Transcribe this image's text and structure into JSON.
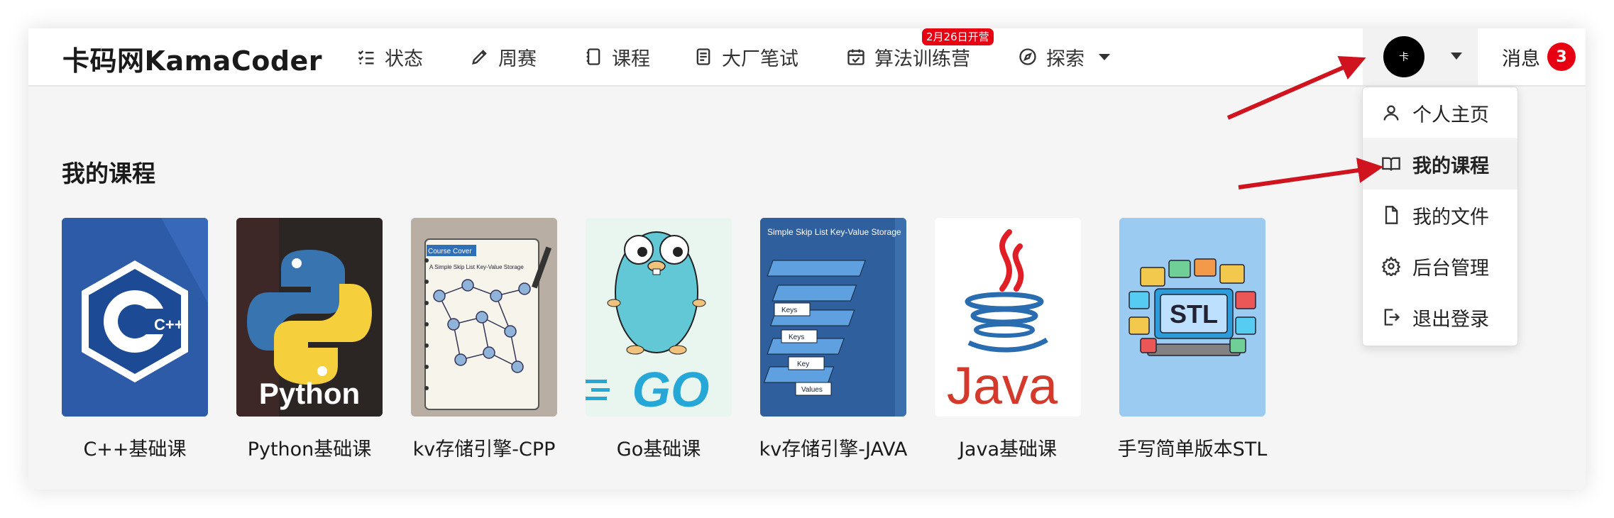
{
  "nav": {
    "logo": "卡码网KamaCoder",
    "items": [
      {
        "label": "状态",
        "icon": "list-check-icon"
      },
      {
        "label": "周赛",
        "icon": "pencil-icon"
      },
      {
        "label": "课程",
        "icon": "notebook-icon"
      },
      {
        "label": "大厂笔试",
        "icon": "document-icon"
      },
      {
        "label": "算法训练营",
        "icon": "calendar-check-icon"
      },
      {
        "label": "探索",
        "icon": "compass-icon"
      }
    ],
    "promo_badge": "2月26日开营",
    "avatar_text": "卡",
    "messages_label": "消息",
    "messages_count": "3"
  },
  "main": {
    "section_title": "我的课程",
    "courses": [
      {
        "name": "C++基础课",
        "cover_text": "C++",
        "bg": "#2b5aa6"
      },
      {
        "name": "Python基础课",
        "cover_text": "Python",
        "bg": "#2a2a2a"
      },
      {
        "name": "kv存储引擎-CPP",
        "cover_text": "A Simple Skip List Key-Value Storage",
        "cover_title": "Course Cover",
        "bg": "#c9c2b8"
      },
      {
        "name": "Go基础课",
        "cover_text": "GO",
        "bg": "#e8f6ee"
      },
      {
        "name": "kv存储引擎-JAVA",
        "cover_text": "Simple Skip List Key-Value Storage",
        "cover_keys": [
          "Keys",
          "Keys",
          "Key",
          "Values"
        ],
        "bg": "#2f6fb8"
      },
      {
        "name": "Java基础课",
        "cover_text": "Java",
        "bg": "#ffffff"
      },
      {
        "name": "手写简单版本STL",
        "cover_text": "STL",
        "bg": "#9ccbf2"
      }
    ]
  },
  "dropdown": {
    "items": [
      {
        "label": "个人主页",
        "icon": "user-icon"
      },
      {
        "label": "我的课程",
        "icon": "book-icon"
      },
      {
        "label": "我的文件",
        "icon": "file-icon"
      },
      {
        "label": "后台管理",
        "icon": "gear-icon"
      },
      {
        "label": "退出登录",
        "icon": "logout-icon"
      }
    ],
    "active_index": 1
  },
  "colors": {
    "accent_red": "#e60012",
    "annotation_arrow": "#d0141f"
  }
}
